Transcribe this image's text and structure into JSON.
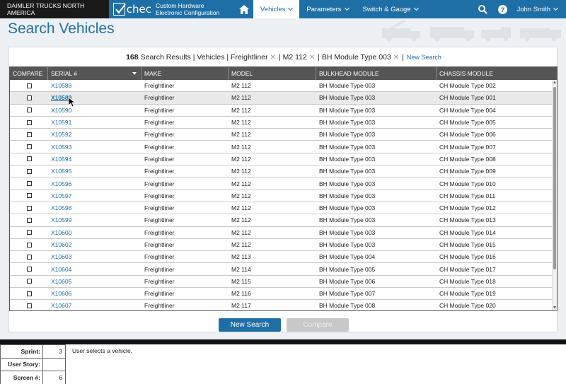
{
  "topbar": {
    "company": "DAIMLER TRUCKS NORTH AMERICA",
    "logo_text": "chec",
    "app_title_line1": "Custom Hardware",
    "app_title_line2": "Electronic Configuration",
    "nav": [
      {
        "label": "Vehicles",
        "active": true
      },
      {
        "label": "Parameters",
        "active": false
      },
      {
        "label": "Switch & Gauge",
        "active": false
      }
    ],
    "user_name": "John Smith"
  },
  "page": {
    "title": "Search Vehicles"
  },
  "summary": {
    "count": "168",
    "results_label": "Search Results | Vehicles | Freightliner",
    "filter_model": "| M2 112",
    "filter_module": "| BH Module Type 003",
    "separator": "|",
    "new_search_link": "New Search"
  },
  "grid": {
    "columns": [
      "COMPARE",
      "SERIAL #",
      "MAKE",
      "MODEL",
      "BULKHEAD MODULE",
      "CHASSIS MODULE"
    ],
    "rows": [
      {
        "serial": "X10588",
        "make": "Freightliner",
        "model": "M2 112",
        "bulkhead": "BH Module Type 003",
        "chassis": "CH Module Type 002"
      },
      {
        "serial": "X10589",
        "make": "Freightliner",
        "model": "M2 112",
        "bulkhead": "BH Module Type 003",
        "chassis": "CH Module Type 001"
      },
      {
        "serial": "X10590",
        "make": "Freightliner",
        "model": "M2 112",
        "bulkhead": "BH Module Type 003",
        "chassis": "CH Module Type 004"
      },
      {
        "serial": "X10591",
        "make": "Freightliner",
        "model": "M2 112",
        "bulkhead": "BH Module Type 003",
        "chassis": "CH Module Type 005"
      },
      {
        "serial": "X10592",
        "make": "Freightliner",
        "model": "M2 112",
        "bulkhead": "BH Module Type 003",
        "chassis": "CH Module Type 006"
      },
      {
        "serial": "X10593",
        "make": "Freightliner",
        "model": "M2 112",
        "bulkhead": "BH Module Type 003",
        "chassis": "CH Module Type 007"
      },
      {
        "serial": "X10594",
        "make": "Freightliner",
        "model": "M2 112",
        "bulkhead": "BH Module Type 003",
        "chassis": "CH Module Type 008"
      },
      {
        "serial": "X10595",
        "make": "Freightliner",
        "model": "M2 112",
        "bulkhead": "BH Module Type 003",
        "chassis": "CH Module Type 009"
      },
      {
        "serial": "X10596",
        "make": "Freightliner",
        "model": "M2 112",
        "bulkhead": "BH Module Type 003",
        "chassis": "CH Module Type 010"
      },
      {
        "serial": "X10597",
        "make": "Freightliner",
        "model": "M2 112",
        "bulkhead": "BH Module Type 003",
        "chassis": "CH Module Type 011"
      },
      {
        "serial": "X10598",
        "make": "Freightliner",
        "model": "M2 112",
        "bulkhead": "BH Module Type 003",
        "chassis": "CH Module Type 012"
      },
      {
        "serial": "X10599",
        "make": "Freightliner",
        "model": "M2 112",
        "bulkhead": "BH Module Type 003",
        "chassis": "CH Module Type 013"
      },
      {
        "serial": "X10600",
        "make": "Freightliner",
        "model": "M2 112",
        "bulkhead": "BH Module Type 003",
        "chassis": "CH Module Type 014"
      },
      {
        "serial": "X10602",
        "make": "Freightliner",
        "model": "M2 112",
        "bulkhead": "BH Module Type 003",
        "chassis": "CH Module Type 015"
      },
      {
        "serial": "X10603",
        "make": "Freightliner",
        "model": "M2 113",
        "bulkhead": "BH Module Type 004",
        "chassis": "CH Module Type 016"
      },
      {
        "serial": "X10604",
        "make": "Freightliner",
        "model": "M2 114",
        "bulkhead": "BH Module Type 005",
        "chassis": "CH Module Type 017"
      },
      {
        "serial": "X10605",
        "make": "Freightliner",
        "model": "M2 115",
        "bulkhead": "BH Module Type 006",
        "chassis": "CH Module Type 018"
      },
      {
        "serial": "X10606",
        "make": "Freightliner",
        "model": "M2 116",
        "bulkhead": "BH Module Type 007",
        "chassis": "CH Module Type 019"
      },
      {
        "serial": "X10607",
        "make": "Freightliner",
        "model": "M2 117",
        "bulkhead": "BH Module Type 008",
        "chassis": "CH Module Type 020"
      }
    ]
  },
  "buttons": {
    "new_search": "New Search",
    "compare": "Compare"
  },
  "footer": {
    "sprint_label": "Sprint:",
    "sprint_value": "3",
    "story_label": "User Story:",
    "story_value": "",
    "screen_label": "Screen #:",
    "screen_value": "6",
    "note": "User selects a vehicle."
  },
  "colors": {
    "brand_blue": "#1f6fa7",
    "header_dark": "#1a1a1a",
    "grid_header": "#555555"
  }
}
